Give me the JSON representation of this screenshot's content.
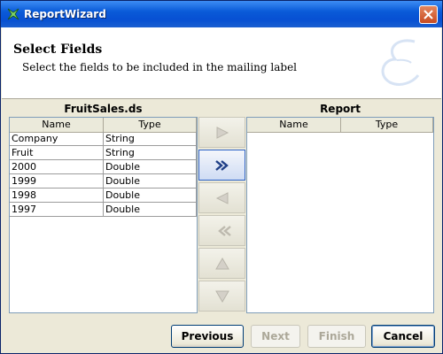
{
  "window": {
    "title": "ReportWizard"
  },
  "header": {
    "title": "Select Fields",
    "subtitle": "Select the fields to be included in the mailing label"
  },
  "source": {
    "title": "FruitSales.ds",
    "columns": [
      "Name",
      "Type"
    ],
    "rows": [
      {
        "name": "Company",
        "type": "String"
      },
      {
        "name": "Fruit",
        "type": "String"
      },
      {
        "name": "2000",
        "type": "Double"
      },
      {
        "name": "1999",
        "type": "Double"
      },
      {
        "name": "1998",
        "type": "Double"
      },
      {
        "name": "1997",
        "type": "Double"
      }
    ]
  },
  "report": {
    "title": "Report",
    "columns": [
      "Name",
      "Type"
    ],
    "rows": []
  },
  "transfer_buttons": [
    {
      "name": "move-right-button",
      "icon": "arrow-right-icon",
      "enabled": false
    },
    {
      "name": "move-all-right-button",
      "icon": "double-chevron-right-icon",
      "enabled": true
    },
    {
      "name": "move-left-button",
      "icon": "arrow-left-icon",
      "enabled": false
    },
    {
      "name": "move-all-left-button",
      "icon": "double-chevron-left-icon",
      "enabled": false
    },
    {
      "name": "move-up-button",
      "icon": "arrow-up-icon",
      "enabled": false
    },
    {
      "name": "move-down-button",
      "icon": "arrow-down-icon",
      "enabled": false
    }
  ],
  "footer": {
    "previous": "Previous",
    "next": "Next",
    "finish": "Finish",
    "cancel": "Cancel"
  },
  "colors": {
    "titlebar": "#0a5bd8",
    "table_border": "#7f9db9",
    "active_button": "#2c62c8",
    "dialog_bg": "#ece9d8"
  }
}
